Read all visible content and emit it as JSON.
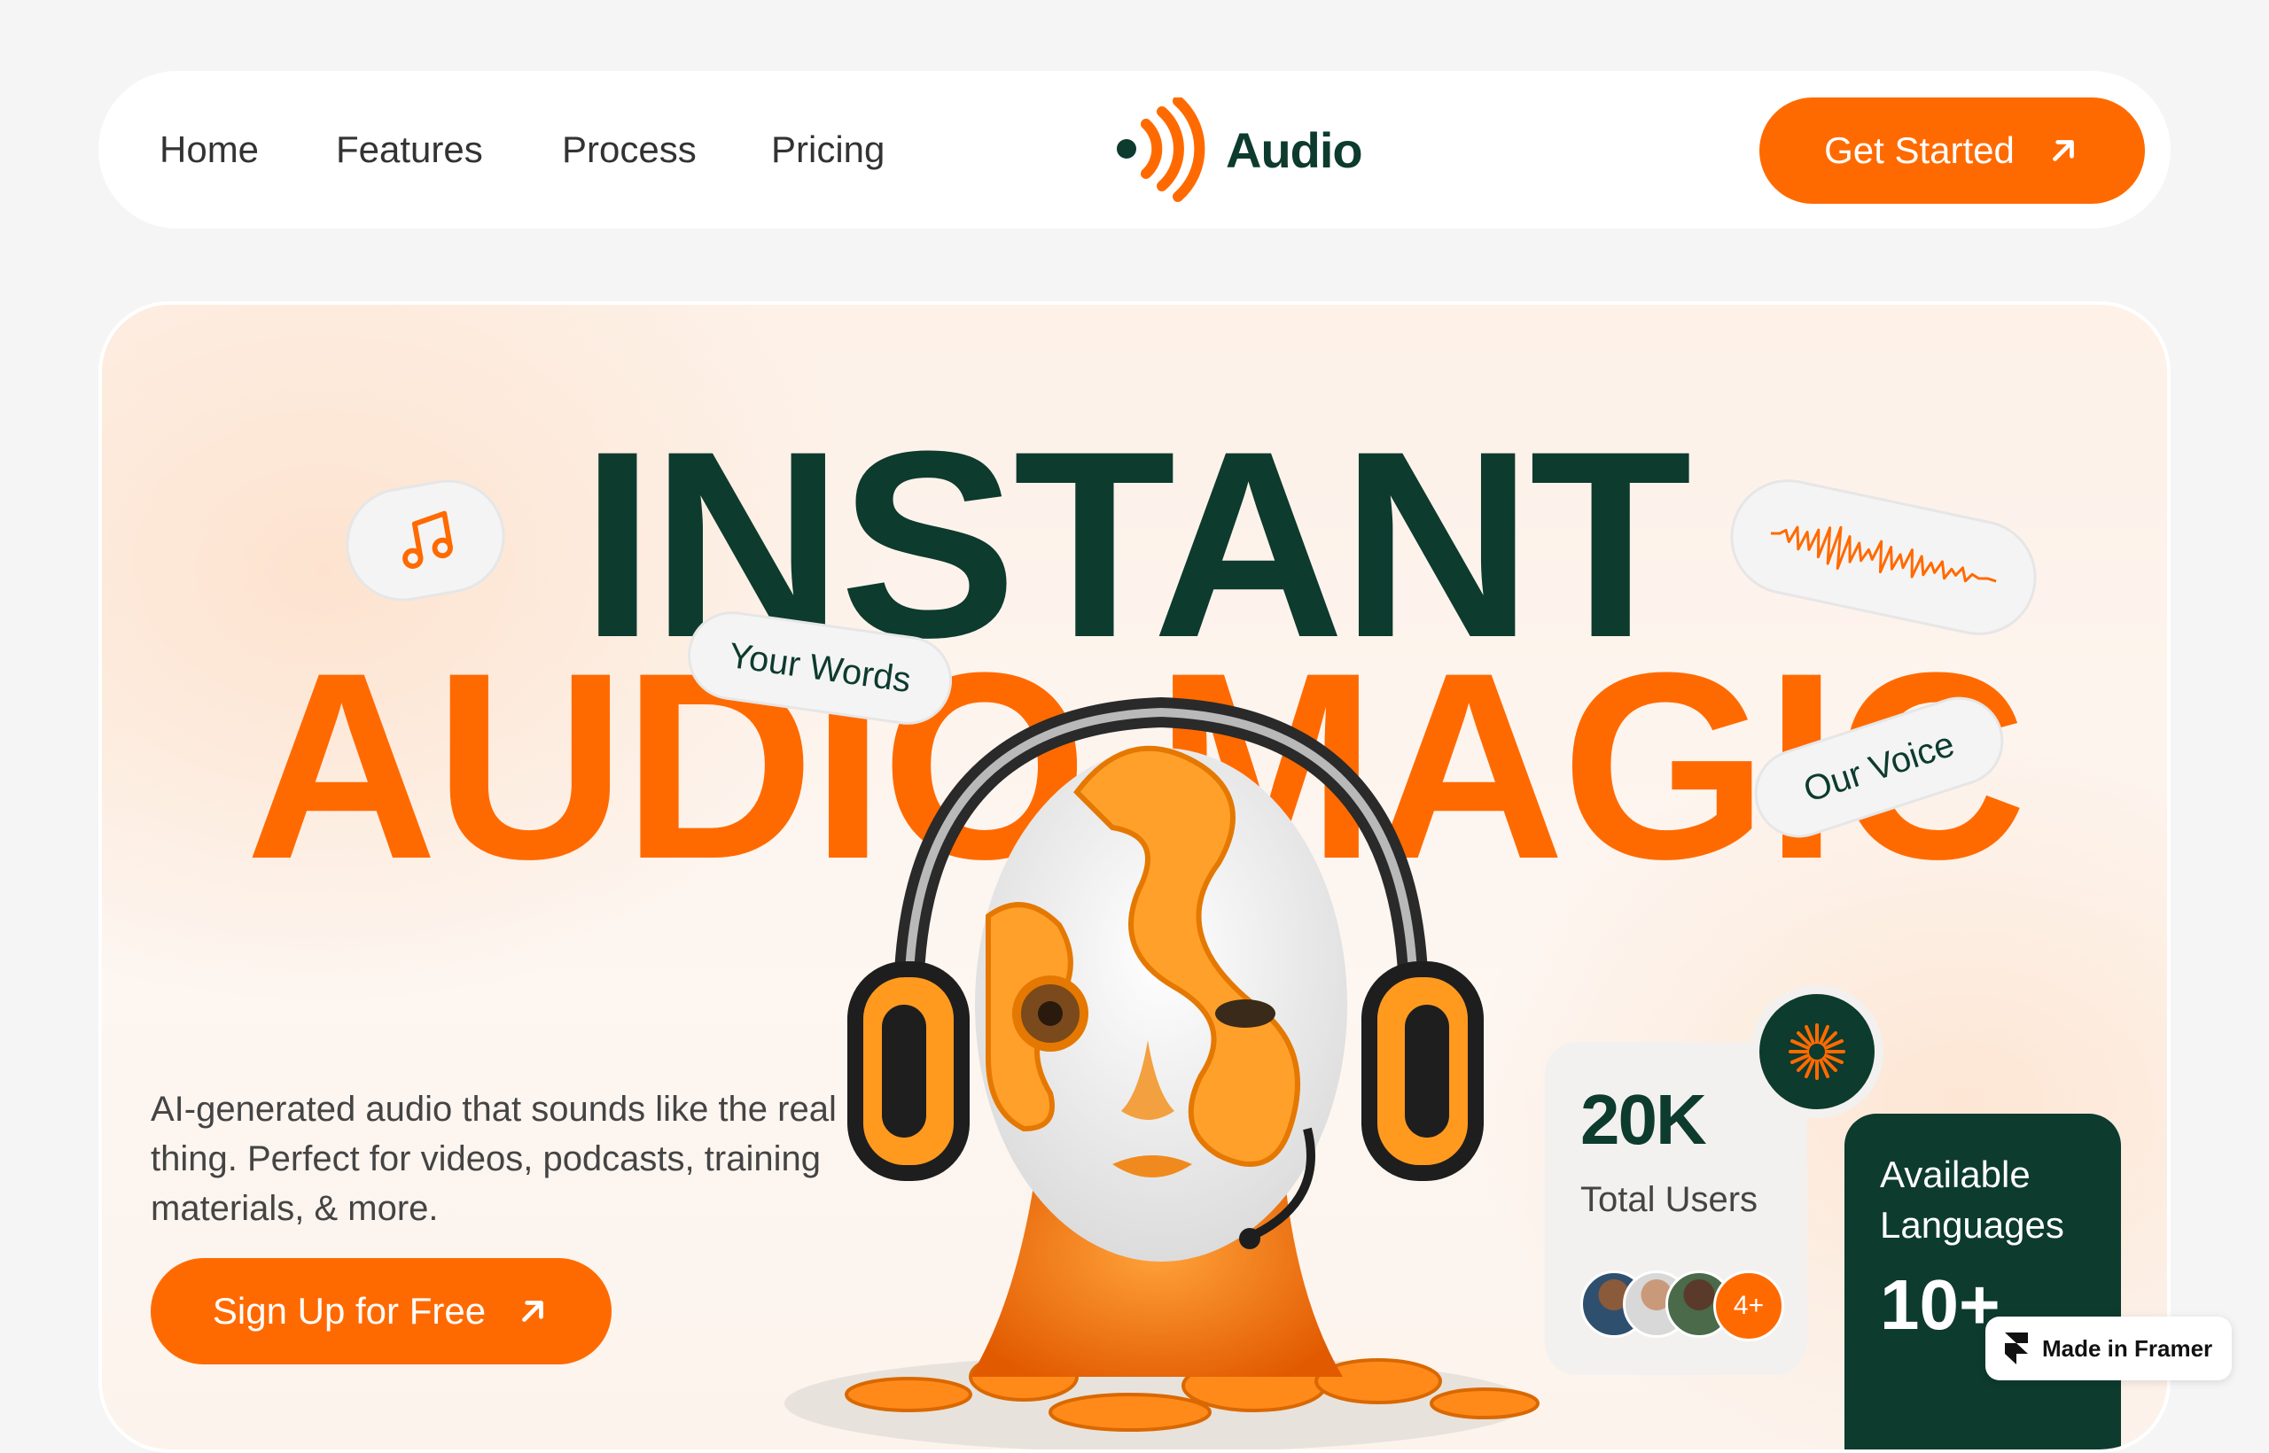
{
  "nav": {
    "links": [
      "Home",
      "Features",
      "Process",
      "Pricing"
    ],
    "logo_text": "Audio",
    "cta": "Get Started"
  },
  "hero": {
    "line1": "INSTANT",
    "line2": "AUDIO MAGIC",
    "pill_words": "Your Words",
    "pill_voice": "Our Voice",
    "description": "AI-generated audio that sounds like the real thing. Perfect for videos, podcasts, training materials, & more.",
    "signup": "Sign Up for Free"
  },
  "stats": {
    "users_value": "20K",
    "users_label": "Total Users",
    "avatars_more": "4+",
    "languages_label": "Available Languages",
    "languages_value": "10+"
  },
  "badge": {
    "text": "Made in Framer"
  },
  "colors": {
    "brand_orange": "#ff6a00",
    "brand_green": "#0d3b2e"
  },
  "icons": [
    "music-note-icon",
    "sound-wave-icon",
    "arrow-up-right-icon",
    "burst-icon",
    "framer-icon"
  ]
}
